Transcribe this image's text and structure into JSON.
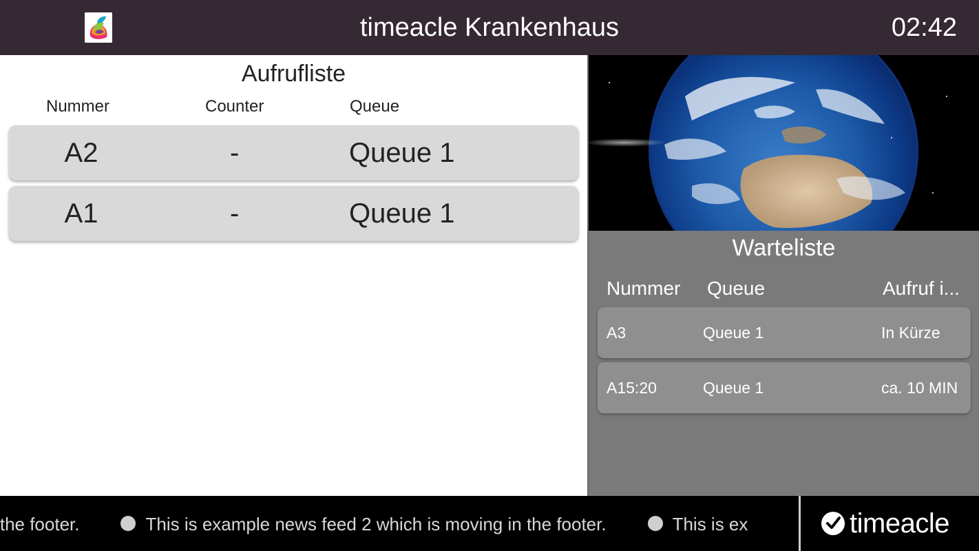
{
  "header": {
    "title": "timeacle Krankenhaus",
    "clock": "02:42",
    "logo_icon": "timeacle-app-logo"
  },
  "call_list": {
    "title": "Aufrufliste",
    "columns": [
      "Nummer",
      "Counter",
      "Queue"
    ],
    "rows": [
      {
        "number": "A2",
        "counter": "-",
        "queue": "Queue 1"
      },
      {
        "number": "A1",
        "counter": "-",
        "queue": "Queue 1"
      }
    ]
  },
  "media": {
    "image": "earth-from-space"
  },
  "wait_list": {
    "title": "Warteliste",
    "columns": [
      "Nummer",
      "Queue",
      "Aufruf i..."
    ],
    "rows": [
      {
        "number": "A3",
        "queue": "Queue 1",
        "eta": "In Kürze"
      },
      {
        "number": "A15:20",
        "queue": "Queue 1",
        "eta": "ca. 10 MIN"
      }
    ]
  },
  "footer": {
    "ticker": [
      "oving in the footer.",
      "This is example news feed 2 which is moving in the footer.",
      "This is ex"
    ],
    "brand": "timeacle",
    "brand_icon": "clock-check-icon"
  },
  "colors": {
    "header_bg": "#352933",
    "row_bg": "#d9d9d9",
    "right_bg": "#7a7a7a",
    "footer_bg": "#000000"
  }
}
